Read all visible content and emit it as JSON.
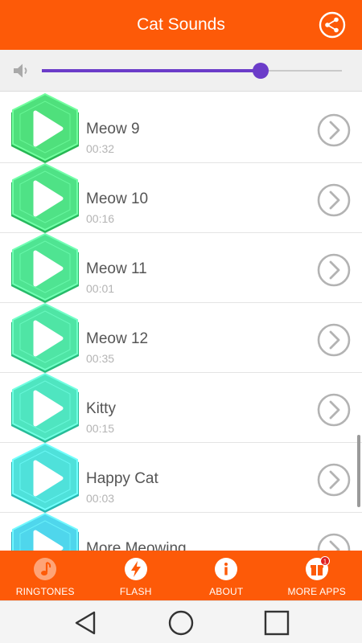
{
  "app": {
    "title": "Cat Sounds"
  },
  "colors": {
    "primary": "#fd5a08",
    "slider": "#6b3cc9"
  },
  "header": {
    "share_icon": "share-icon"
  },
  "volume": {
    "icon": "volume-icon",
    "level": 0.73
  },
  "sounds": [
    {
      "name": "Meow 9",
      "duration": "00:32",
      "hex_color": "#4fe07c"
    },
    {
      "name": "Meow 10",
      "duration": "00:16",
      "hex_color": "#4fe286"
    },
    {
      "name": "Meow 11",
      "duration": "00:01",
      "hex_color": "#4fe492"
    },
    {
      "name": "Meow 12",
      "duration": "00:35",
      "hex_color": "#4fe5a5"
    },
    {
      "name": "Kitty",
      "duration": "00:15",
      "hex_color": "#4fe5c0"
    },
    {
      "name": "Happy Cat",
      "duration": "00:03",
      "hex_color": "#4fe1da"
    },
    {
      "name": "More Meowing",
      "duration": "",
      "hex_color": "#4fd6ec"
    }
  ],
  "tabs": [
    {
      "label": "RINGTONES",
      "icon": "music-note-icon"
    },
    {
      "label": "FLASH",
      "icon": "flash-icon"
    },
    {
      "label": "ABOUT",
      "icon": "info-icon"
    },
    {
      "label": "MORE APPS",
      "icon": "gift-icon",
      "badge": "1"
    }
  ],
  "system_nav": [
    "back-icon",
    "home-icon",
    "recents-icon"
  ]
}
